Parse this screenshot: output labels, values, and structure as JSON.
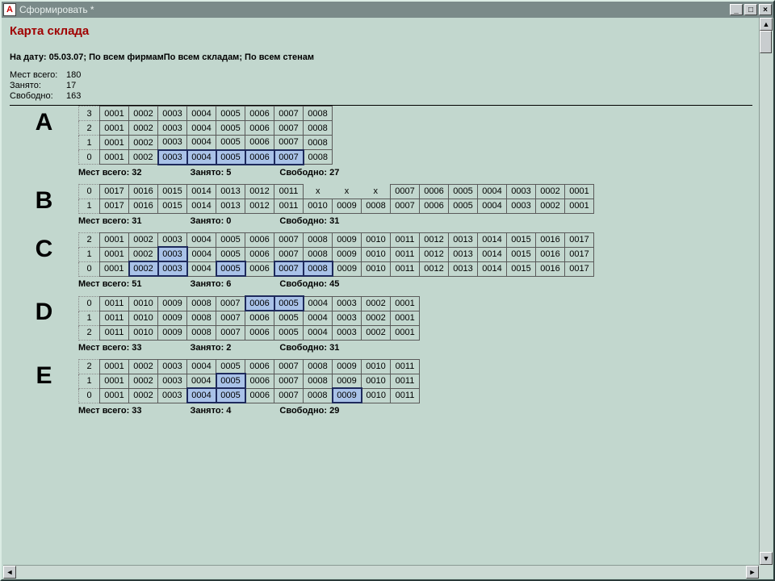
{
  "window": {
    "title": "Сформировать  *"
  },
  "report": {
    "title": "Карта склада",
    "header_line": "На дату: 05.03.07; По всем фирмамПо всем складам; По всем стенам"
  },
  "summary": {
    "total_label": "Мест всего:",
    "total_value": "180",
    "occupied_label": "Занято:",
    "occupied_value": "17",
    "free_label": "Свободно:",
    "free_value": "163"
  },
  "sections": [
    {
      "letter": "A",
      "stats": {
        "total_label": "Мест всего: 32",
        "occ_label": "Занято: 5",
        "free_label": "Свободно: 27"
      },
      "rows": [
        {
          "idx": "3",
          "cells": [
            {
              "v": "0001"
            },
            {
              "v": "0002"
            },
            {
              "v": "0003"
            },
            {
              "v": "0004"
            },
            {
              "v": "0005"
            },
            {
              "v": "0006"
            },
            {
              "v": "0007"
            },
            {
              "v": "0008"
            }
          ]
        },
        {
          "idx": "2",
          "cells": [
            {
              "v": "0001"
            },
            {
              "v": "0002"
            },
            {
              "v": "0003"
            },
            {
              "v": "0004"
            },
            {
              "v": "0005"
            },
            {
              "v": "0006"
            },
            {
              "v": "0007"
            },
            {
              "v": "0008"
            }
          ]
        },
        {
          "idx": "1",
          "cells": [
            {
              "v": "0001"
            },
            {
              "v": "0002"
            },
            {
              "v": "0003"
            },
            {
              "v": "0004"
            },
            {
              "v": "0005"
            },
            {
              "v": "0006"
            },
            {
              "v": "0007"
            },
            {
              "v": "0008"
            }
          ]
        },
        {
          "idx": "0",
          "cells": [
            {
              "v": "0001"
            },
            {
              "v": "0002"
            },
            {
              "v": "0003",
              "hl": true
            },
            {
              "v": "0004",
              "hl": true
            },
            {
              "v": "0005",
              "hl": true
            },
            {
              "v": "0006",
              "hl": true
            },
            {
              "v": "0007",
              "hl": true
            },
            {
              "v": "0008"
            }
          ]
        }
      ]
    },
    {
      "letter": "B",
      "stats": {
        "total_label": "Мест всего: 31",
        "occ_label": "Занято: 0",
        "free_label": "Свободно: 31"
      },
      "rows": [
        {
          "idx": "0",
          "cells": [
            {
              "v": "0017"
            },
            {
              "v": "0016"
            },
            {
              "v": "0015"
            },
            {
              "v": "0014"
            },
            {
              "v": "0013"
            },
            {
              "v": "0012"
            },
            {
              "v": "0011"
            },
            {
              "v": "x",
              "gap": true
            },
            {
              "v": "x",
              "gap": true
            },
            {
              "v": "x",
              "gap": true
            },
            {
              "v": "0007"
            },
            {
              "v": "0006"
            },
            {
              "v": "0005"
            },
            {
              "v": "0004"
            },
            {
              "v": "0003"
            },
            {
              "v": "0002"
            },
            {
              "v": "0001"
            }
          ]
        },
        {
          "idx": "1",
          "cells": [
            {
              "v": "0017"
            },
            {
              "v": "0016"
            },
            {
              "v": "0015"
            },
            {
              "v": "0014"
            },
            {
              "v": "0013"
            },
            {
              "v": "0012"
            },
            {
              "v": "0011"
            },
            {
              "v": "0010"
            },
            {
              "v": "0009"
            },
            {
              "v": "0008"
            },
            {
              "v": "0007"
            },
            {
              "v": "0006"
            },
            {
              "v": "0005"
            },
            {
              "v": "0004"
            },
            {
              "v": "0003"
            },
            {
              "v": "0002"
            },
            {
              "v": "0001"
            }
          ]
        }
      ]
    },
    {
      "letter": "C",
      "stats": {
        "total_label": "Мест всего: 51",
        "occ_label": "Занято: 6",
        "free_label": "Свободно: 45"
      },
      "rows": [
        {
          "idx": "2",
          "cells": [
            {
              "v": "0001"
            },
            {
              "v": "0002"
            },
            {
              "v": "0003"
            },
            {
              "v": "0004"
            },
            {
              "v": "0005"
            },
            {
              "v": "0006"
            },
            {
              "v": "0007"
            },
            {
              "v": "0008"
            },
            {
              "v": "0009"
            },
            {
              "v": "0010"
            },
            {
              "v": "0011"
            },
            {
              "v": "0012"
            },
            {
              "v": "0013"
            },
            {
              "v": "0014"
            },
            {
              "v": "0015"
            },
            {
              "v": "0016"
            },
            {
              "v": "0017"
            }
          ]
        },
        {
          "idx": "1",
          "cells": [
            {
              "v": "0001"
            },
            {
              "v": "0002"
            },
            {
              "v": "0003",
              "hl": true
            },
            {
              "v": "0004"
            },
            {
              "v": "0005"
            },
            {
              "v": "0006"
            },
            {
              "v": "0007"
            },
            {
              "v": "0008"
            },
            {
              "v": "0009"
            },
            {
              "v": "0010"
            },
            {
              "v": "0011"
            },
            {
              "v": "0012"
            },
            {
              "v": "0013"
            },
            {
              "v": "0014"
            },
            {
              "v": "0015"
            },
            {
              "v": "0016"
            },
            {
              "v": "0017"
            }
          ]
        },
        {
          "idx": "0",
          "cells": [
            {
              "v": "0001"
            },
            {
              "v": "0002",
              "hl": true
            },
            {
              "v": "0003",
              "hl": true
            },
            {
              "v": "0004"
            },
            {
              "v": "0005",
              "hl": true
            },
            {
              "v": "0006"
            },
            {
              "v": "0007",
              "hl": true
            },
            {
              "v": "0008",
              "hl": true
            },
            {
              "v": "0009"
            },
            {
              "v": "0010"
            },
            {
              "v": "0011"
            },
            {
              "v": "0012"
            },
            {
              "v": "0013"
            },
            {
              "v": "0014"
            },
            {
              "v": "0015"
            },
            {
              "v": "0016"
            },
            {
              "v": "0017"
            }
          ]
        }
      ]
    },
    {
      "letter": "D",
      "stats": {
        "total_label": "Мест всего: 33",
        "occ_label": "Занято: 2",
        "free_label": "Свободно: 31"
      },
      "rows": [
        {
          "idx": "0",
          "cells": [
            {
              "v": "0011"
            },
            {
              "v": "0010"
            },
            {
              "v": "0009"
            },
            {
              "v": "0008"
            },
            {
              "v": "0007"
            },
            {
              "v": "0006",
              "hl": true
            },
            {
              "v": "0005",
              "hl": true
            },
            {
              "v": "0004"
            },
            {
              "v": "0003"
            },
            {
              "v": "0002"
            },
            {
              "v": "0001"
            }
          ]
        },
        {
          "idx": "1",
          "cells": [
            {
              "v": "0011"
            },
            {
              "v": "0010"
            },
            {
              "v": "0009"
            },
            {
              "v": "0008"
            },
            {
              "v": "0007"
            },
            {
              "v": "0006"
            },
            {
              "v": "0005"
            },
            {
              "v": "0004"
            },
            {
              "v": "0003"
            },
            {
              "v": "0002"
            },
            {
              "v": "0001"
            }
          ]
        },
        {
          "idx": "2",
          "cells": [
            {
              "v": "0011"
            },
            {
              "v": "0010"
            },
            {
              "v": "0009"
            },
            {
              "v": "0008"
            },
            {
              "v": "0007"
            },
            {
              "v": "0006"
            },
            {
              "v": "0005"
            },
            {
              "v": "0004"
            },
            {
              "v": "0003"
            },
            {
              "v": "0002"
            },
            {
              "v": "0001"
            }
          ]
        }
      ]
    },
    {
      "letter": "E",
      "stats": {
        "total_label": "Мест всего: 33",
        "occ_label": "Занято: 4",
        "free_label": "Свободно: 29"
      },
      "rows": [
        {
          "idx": "2",
          "cells": [
            {
              "v": "0001"
            },
            {
              "v": "0002"
            },
            {
              "v": "0003"
            },
            {
              "v": "0004"
            },
            {
              "v": "0005"
            },
            {
              "v": "0006"
            },
            {
              "v": "0007"
            },
            {
              "v": "0008"
            },
            {
              "v": "0009"
            },
            {
              "v": "0010"
            },
            {
              "v": "0011"
            }
          ]
        },
        {
          "idx": "1",
          "cells": [
            {
              "v": "0001"
            },
            {
              "v": "0002"
            },
            {
              "v": "0003"
            },
            {
              "v": "0004"
            },
            {
              "v": "0005",
              "hl": true
            },
            {
              "v": "0006"
            },
            {
              "v": "0007"
            },
            {
              "v": "0008"
            },
            {
              "v": "0009"
            },
            {
              "v": "0010"
            },
            {
              "v": "0011"
            }
          ]
        },
        {
          "idx": "0",
          "cells": [
            {
              "v": "0001"
            },
            {
              "v": "0002"
            },
            {
              "v": "0003"
            },
            {
              "v": "0004",
              "hl": true
            },
            {
              "v": "0005",
              "hl": true
            },
            {
              "v": "0006"
            },
            {
              "v": "0007"
            },
            {
              "v": "0008"
            },
            {
              "v": "0009",
              "hl": true
            },
            {
              "v": "0010"
            },
            {
              "v": "0011"
            }
          ]
        }
      ]
    }
  ]
}
